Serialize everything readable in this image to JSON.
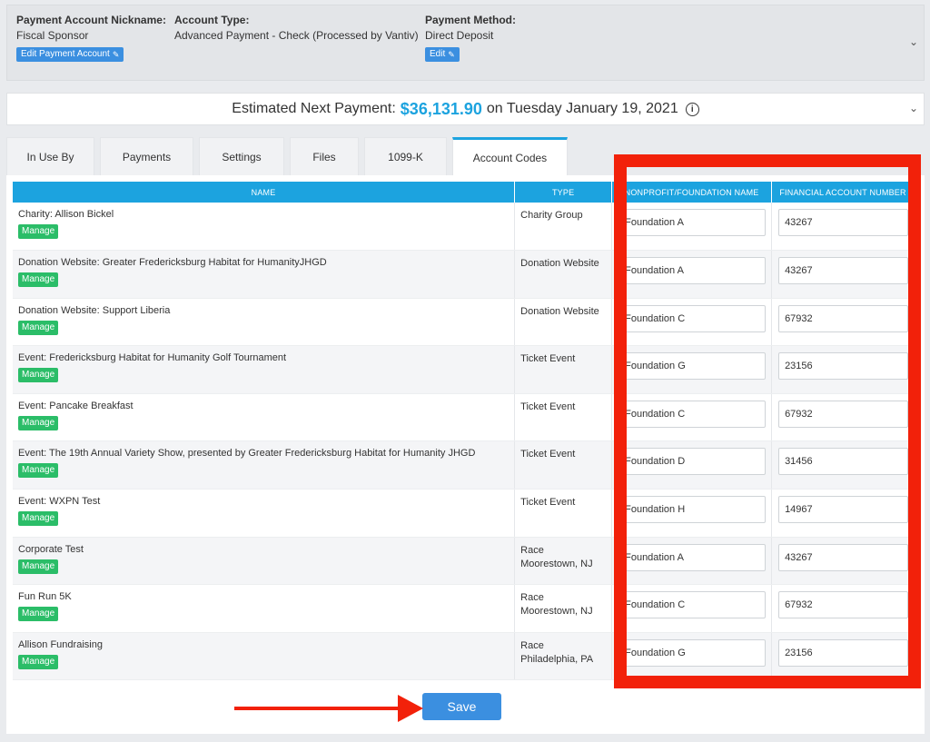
{
  "account": {
    "nickname_label": "Payment Account Nickname:",
    "nickname_value": "Fiscal Sponsor",
    "edit_account_label": "Edit Payment Account",
    "type_label": "Account Type:",
    "type_value": "Advanced Payment - Check (Processed by Vantiv)",
    "method_label": "Payment Method:",
    "method_value": "Direct Deposit",
    "edit_method_label": "Edit"
  },
  "payment": {
    "prefix": "Estimated Next Payment:",
    "amount": "$36,131.90",
    "suffix": "on Tuesday January 19, 2021"
  },
  "tabs": [
    {
      "label": "In Use By"
    },
    {
      "label": "Payments"
    },
    {
      "label": "Settings"
    },
    {
      "label": "Files"
    },
    {
      "label": "1099-K"
    },
    {
      "label": "Account Codes"
    }
  ],
  "active_tab": "Account Codes",
  "table": {
    "headers": [
      "NAME",
      "TYPE",
      "NONPROFIT/FOUNDATION NAME",
      "FINANCIAL ACCOUNT NUMBER"
    ],
    "manage_label": "Manage",
    "rows": [
      {
        "name": "Charity: Allison Bickel",
        "type1": "Charity Group",
        "type2": "",
        "foundation": "Foundation A",
        "account": "43267"
      },
      {
        "name": "Donation Website: Greater Fredericksburg Habitat for HumanityJHGD",
        "type1": "Donation Website",
        "type2": "",
        "foundation": "Foundation A",
        "account": "43267"
      },
      {
        "name": "Donation Website: Support Liberia",
        "type1": "Donation Website",
        "type2": "",
        "foundation": "Foundation C",
        "account": "67932"
      },
      {
        "name": "Event: Fredericksburg Habitat for Humanity Golf Tournament",
        "type1": "Ticket Event",
        "type2": "",
        "foundation": "Foundation G",
        "account": "23156"
      },
      {
        "name": "Event: Pancake Breakfast",
        "type1": "Ticket Event",
        "type2": "",
        "foundation": "Foundation C",
        "account": "67932"
      },
      {
        "name": "Event: The 19th Annual Variety Show, presented by Greater Fredericksburg Habitat for Humanity JHGD",
        "type1": "Ticket Event",
        "type2": "",
        "foundation": "Foundation D",
        "account": "31456"
      },
      {
        "name": "Event: WXPN Test",
        "type1": "Ticket Event",
        "type2": "",
        "foundation": "Foundation H",
        "account": "14967"
      },
      {
        "name": "Corporate Test",
        "type1": "Race",
        "type2": "Moorestown, NJ",
        "foundation": "Foundation A",
        "account": "43267"
      },
      {
        "name": "Fun Run 5K",
        "type1": "Race",
        "type2": "Moorestown, NJ",
        "foundation": "Foundation C",
        "account": "67932"
      },
      {
        "name": "Allison Fundraising",
        "type1": "Race",
        "type2": "Philadelphia, PA",
        "foundation": "Foundation G",
        "account": "23156"
      }
    ]
  },
  "save_label": "Save",
  "colors": {
    "accent": "#1ca3df",
    "button_blue": "#3b8fe0",
    "manage_green": "#2bbd68",
    "annotation_red": "#f2210a"
  },
  "icons": [
    "edit-icon",
    "chevron-down-icon",
    "info-icon",
    "red-arrow-annotation",
    "red-box-annotation"
  ]
}
